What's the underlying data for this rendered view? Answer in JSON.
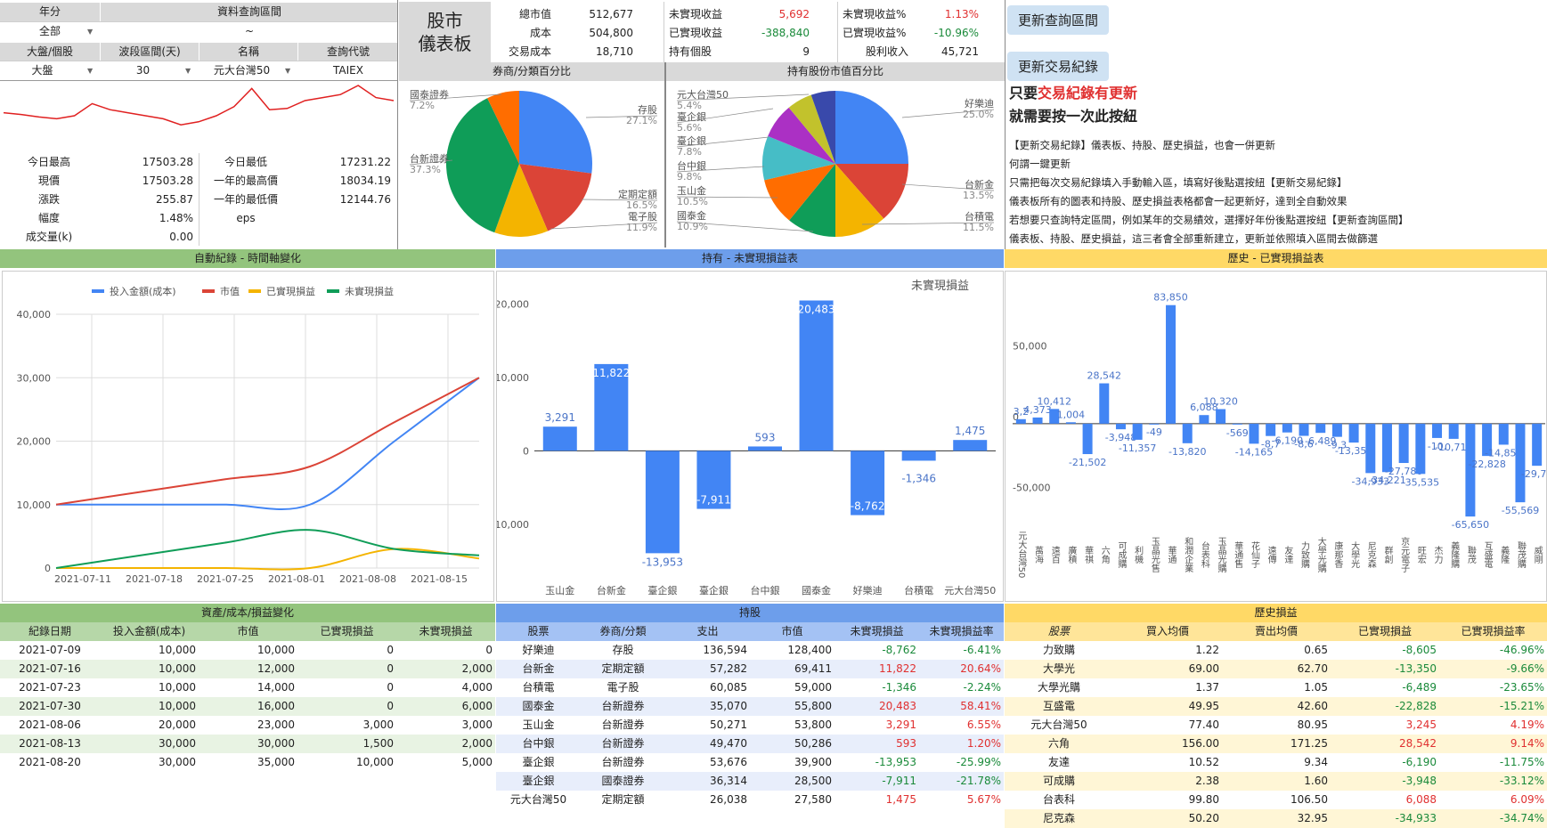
{
  "query": {
    "year_label": "年分",
    "year_value": "全部",
    "range_label": "資料查詢區間",
    "range_value": "~",
    "market_label": "大盤/個股",
    "market_value": "大盤",
    "wave_label": "波段區間(天)",
    "wave_value": "30",
    "name_label": "名稱",
    "name_value": "元大台灣50",
    "code_label": "查詢代號",
    "code_value": "TAIEX"
  },
  "title": {
    "line1": "股市",
    "line2": "儀表板"
  },
  "summary": {
    "market_value_label": "總市值",
    "market_value": "512,677",
    "cost_label": "成本",
    "cost": "504,800",
    "fee_label": "交易成本",
    "fee": "18,710",
    "unrealized_label": "未實現收益",
    "unrealized": "5,692",
    "realized_label": "已實現收益",
    "realized": "-388,840",
    "holding_count_label": "持有個股",
    "holding_count": "9",
    "unrealized_pct_label": "未實現收益%",
    "unrealized_pct": "1.13%",
    "realized_pct_label": "已實現收益%",
    "realized_pct": "-10.96%",
    "dividend_label": "股利收入",
    "dividend": "45,721"
  },
  "buttons": {
    "update_range": "更新查詢區間",
    "update_trades": "更新交易紀錄"
  },
  "notes": {
    "warn_prefix": "只要",
    "warn_highlight": "交易紀錄有更新",
    "warn_line2": "就需要按一次此按紐",
    "lines": [
      "【更新交易紀錄】儀表板、持股、歷史損益，也會一併更新",
      "何謂一鍵更新",
      "只需把每次交易紀錄填入手動輸入區，填寫好後點選按紐【更新交易紀錄】",
      "儀表板所有的圖表和持股、歷史損益表格都會一起更新好，達到全自動效果",
      "若想要只查詢特定區間，例如某年的交易績效，選擇好年份後點選按紐【更新查詢區間】",
      "儀表板、持股、歷史損益，這三者會全部重新建立，更新並依照填入區間去做篩選"
    ]
  },
  "index_stats": [
    {
      "label": "今日最高",
      "value": "17503.28"
    },
    {
      "label": "現價",
      "value": "17503.28"
    },
    {
      "label": "漲跌",
      "value": "255.87"
    },
    {
      "label": "幅度",
      "value": "1.48%"
    },
    {
      "label": "成交量(k)",
      "value": "0.00"
    }
  ],
  "index_stats2": [
    {
      "label": "今日最低",
      "value": "17231.22"
    },
    {
      "label": "一年的最高價",
      "value": "18034.19"
    },
    {
      "label": "一年的最低價",
      "value": "12144.76"
    },
    {
      "label": "eps",
      "value": ""
    }
  ],
  "sparkline": [
    0.55,
    0.52,
    0.48,
    0.45,
    0.5,
    0.7,
    0.6,
    0.55,
    0.5,
    0.45,
    0.35,
    0.4,
    0.5,
    0.65,
    0.95,
    0.6,
    0.62,
    0.75,
    0.8,
    0.85,
    1.0,
    0.8,
    0.75
  ],
  "pie1": {
    "title": "券商/分類百分比",
    "slices": [
      {
        "name": "存股",
        "pct": 27.1,
        "color": "#4285f4"
      },
      {
        "name": "定期定額",
        "pct": 16.5,
        "color": "#db4437"
      },
      {
        "name": "電子股",
        "pct": 11.9,
        "color": "#f4b400"
      },
      {
        "name": "台新證券",
        "pct": 37.3,
        "color": "#0f9d58"
      },
      {
        "name": "國泰證券",
        "pct": 7.2,
        "color": "#ff6d00"
      }
    ],
    "labels": [
      {
        "name": "國泰證券",
        "pct": "7.2%"
      },
      {
        "name": "存股",
        "pct": "27.1%"
      },
      {
        "name": "台新證券",
        "pct": "37.3%"
      },
      {
        "name": "定期定額",
        "pct": "16.5%"
      },
      {
        "name": "電子股",
        "pct": "11.9%"
      }
    ]
  },
  "pie2": {
    "title": "持有股份市值百分比",
    "slices": [
      {
        "name": "好樂迪",
        "pct": 25.0,
        "color": "#4285f4"
      },
      {
        "name": "台新金",
        "pct": 13.5,
        "color": "#db4437"
      },
      {
        "name": "台積電",
        "pct": 11.5,
        "color": "#f4b400"
      },
      {
        "name": "國泰金",
        "pct": 10.9,
        "color": "#0f9d58"
      },
      {
        "name": "玉山金",
        "pct": 10.5,
        "color": "#ff6d00"
      },
      {
        "name": "台中銀",
        "pct": 9.8,
        "color": "#46bdc6"
      },
      {
        "name": "臺企銀",
        "pct": 7.8,
        "color": "#ab30c4"
      },
      {
        "name": "臺企銀",
        "pct": 5.6,
        "color": "#c2c22c"
      },
      {
        "name": "元大台灣50",
        "pct": 5.4,
        "color": "#3949ab"
      }
    ],
    "labels": [
      {
        "name": "元大台灣50",
        "pct": "5.4%"
      },
      {
        "name": "臺企銀",
        "pct": "5.6%"
      },
      {
        "name": "臺企銀",
        "pct": "7.8%"
      },
      {
        "name": "台中銀",
        "pct": "9.8%"
      },
      {
        "name": "玉山金",
        "pct": "10.5%"
      },
      {
        "name": "國泰金",
        "pct": "10.9%"
      },
      {
        "name": "好樂迪",
        "pct": "25.0%"
      },
      {
        "name": "台新金",
        "pct": "13.5%"
      },
      {
        "name": "台積電",
        "pct": "11.5%"
      }
    ]
  },
  "sections": {
    "auto_record": "自動紀錄 - 時間軸變化",
    "holding_unrealized": "持有 - 未實現損益表",
    "history_realized": "歷史 - 已實現損益表",
    "asset_change": "資產/成本/損益變化",
    "holding": "持股",
    "history": "歷史損益"
  },
  "chart_data": [
    {
      "type": "line",
      "title": "",
      "x": [
        "2021-07-11",
        "2021-07-18",
        "2021-07-25",
        "2021-08-01",
        "2021-08-08",
        "2021-08-15"
      ],
      "ylim": [
        0,
        40000
      ],
      "yticks": [
        "40,000",
        "30,000",
        "20,000",
        "10,000",
        "0"
      ],
      "series": [
        {
          "name": "投入金額(成本)",
          "color": "#4285f4",
          "values": [
            10000,
            10000,
            10000,
            10000,
            20000,
            30000
          ]
        },
        {
          "name": "市值",
          "color": "#db4437",
          "values": [
            10000,
            12000,
            14000,
            16000,
            23000,
            30000
          ]
        },
        {
          "name": "已實現損益",
          "color": "#f4b400",
          "values": [
            0,
            0,
            0,
            0,
            3000,
            1500
          ]
        },
        {
          "name": "未實現損益",
          "color": "#0f9d58",
          "values": [
            0,
            2000,
            4000,
            6000,
            3000,
            2000
          ]
        }
      ]
    },
    {
      "type": "bar",
      "title": "未實現損益",
      "categories": [
        "玉山金",
        "台新金",
        "臺企銀",
        "臺企銀",
        "台中銀",
        "國泰金",
        "好樂迪",
        "台積電",
        "元大台灣50"
      ],
      "values": [
        3291,
        11822,
        -13953,
        -7911,
        593,
        20483,
        -8762,
        -1346,
        1475
      ],
      "value_labels": [
        "3,291",
        "11,822",
        "-13,953",
        "-7,911",
        "593",
        "20,483",
        "-8,762",
        "-1,346",
        "1,475"
      ],
      "yticks": [
        "20,000",
        "10,000",
        "0",
        "-10,000"
      ],
      "ylim": [
        -15000,
        22000
      ]
    },
    {
      "type": "bar",
      "title": "",
      "values": [
        3200,
        4373,
        10412,
        1004,
        -21502,
        28542,
        -3948,
        -11357,
        -49,
        83850,
        -13820,
        6088,
        10320,
        -569,
        -14165,
        -8700,
        -6190,
        -8600,
        -6489,
        -9300,
        -13350,
        -34933,
        -34221,
        -27780,
        -35535,
        -10100,
        -10716,
        -65650,
        -22828,
        -14850,
        -55569,
        -29760
      ],
      "value_labels": [
        "3,2",
        "4,373",
        "10,412",
        "1,004",
        "-21,502",
        "28,542",
        "-3,948",
        "-11,357",
        "-49",
        "83,850",
        "-13,820",
        "6,088",
        "10,320",
        "-569",
        "-14,165",
        "-8,7",
        "-6,190",
        "-8,6",
        "-6,489",
        "-9,3",
        "-13,350",
        "-34,933",
        "-34,221",
        "-27,780",
        "-35,535",
        "-10,",
        "-10,716",
        "-65,650",
        "-22,828",
        "-14,850",
        "-55,569",
        "-29,76"
      ],
      "categories_visible": [
        "元大台灣50",
        "萬海",
        "遠百",
        "廣積",
        "華祺",
        "六角",
        "可成購",
        "利機",
        "玉晶光售",
        "華通",
        "和潤企業",
        "台表科",
        "玉晶光購",
        "華通售",
        "花仙子",
        "遠傳",
        "友達",
        "力致購",
        "大學光購",
        "康那香",
        "大學光",
        "尼克森",
        "群創",
        "京元電子",
        "旺宏",
        "杰力",
        "義隆購",
        "聯茂",
        "互盛電",
        "義隆",
        "聯茂購",
        "威剛"
      ],
      "yticks": [
        "50,000",
        "0",
        "-50,000"
      ],
      "ylim": [
        -75000,
        95000
      ]
    }
  ],
  "asset_table": {
    "headers": [
      "紀錄日期",
      "投入金額(成本)",
      "市值",
      "已實現損益",
      "未實現損益"
    ],
    "rows": [
      [
        "2021-07-09",
        "10,000",
        "10,000",
        "0",
        "0"
      ],
      [
        "2021-07-16",
        "10,000",
        "12,000",
        "0",
        "2,000"
      ],
      [
        "2021-07-23",
        "10,000",
        "14,000",
        "0",
        "4,000"
      ],
      [
        "2021-07-30",
        "10,000",
        "16,000",
        "0",
        "6,000"
      ],
      [
        "2021-08-06",
        "20,000",
        "23,000",
        "3,000",
        "3,000"
      ],
      [
        "2021-08-13",
        "30,000",
        "30,000",
        "1,500",
        "2,000"
      ],
      [
        "2021-08-20",
        "30,000",
        "35,000",
        "10,000",
        "5,000"
      ]
    ]
  },
  "holding_table": {
    "headers": [
      "股票",
      "券商/分類",
      "支出",
      "市值",
      "未實現損益",
      "未實現損益率"
    ],
    "rows": [
      [
        "好樂迪",
        "存股",
        "136,594",
        "128,400",
        "-8,762",
        "-6.41%"
      ],
      [
        "台新金",
        "定期定額",
        "57,282",
        "69,411",
        "11,822",
        "20.64%"
      ],
      [
        "台積電",
        "電子股",
        "60,085",
        "59,000",
        "-1,346",
        "-2.24%"
      ],
      [
        "國泰金",
        "台新證券",
        "35,070",
        "55,800",
        "20,483",
        "58.41%"
      ],
      [
        "玉山金",
        "台新證券",
        "50,271",
        "53,800",
        "3,291",
        "6.55%"
      ],
      [
        "台中銀",
        "台新證券",
        "49,470",
        "50,286",
        "593",
        "1.20%"
      ],
      [
        "臺企銀",
        "台新證券",
        "53,676",
        "39,900",
        "-13,953",
        "-25.99%"
      ],
      [
        "臺企銀",
        "國泰證券",
        "36,314",
        "28,500",
        "-7,911",
        "-21.78%"
      ],
      [
        "元大台灣50",
        "定期定額",
        "26,038",
        "27,580",
        "1,475",
        "5.67%"
      ]
    ]
  },
  "history_table": {
    "headers": [
      "股票",
      "買入均價",
      "賣出均價",
      "已實現損益",
      "已實現損益率"
    ],
    "rows": [
      [
        "力致購",
        "1.22",
        "0.65",
        "-8,605",
        "-46.96%"
      ],
      [
        "大學光",
        "69.00",
        "62.70",
        "-13,350",
        "-9.66%"
      ],
      [
        "大學光購",
        "1.37",
        "1.05",
        "-6,489",
        "-23.65%"
      ],
      [
        "互盛電",
        "49.95",
        "42.60",
        "-22,828",
        "-15.21%"
      ],
      [
        "元大台灣50",
        "77.40",
        "80.95",
        "3,245",
        "4.19%"
      ],
      [
        "六角",
        "156.00",
        "171.25",
        "28,542",
        "9.14%"
      ],
      [
        "友達",
        "10.52",
        "9.34",
        "-6,190",
        "-11.75%"
      ],
      [
        "可成購",
        "2.38",
        "1.60",
        "-3,948",
        "-33.12%"
      ],
      [
        "台表科",
        "99.80",
        "106.50",
        "6,088",
        "6.09%"
      ],
      [
        "尼克森",
        "50.20",
        "32.95",
        "-34,933",
        "-34.74%"
      ]
    ]
  }
}
